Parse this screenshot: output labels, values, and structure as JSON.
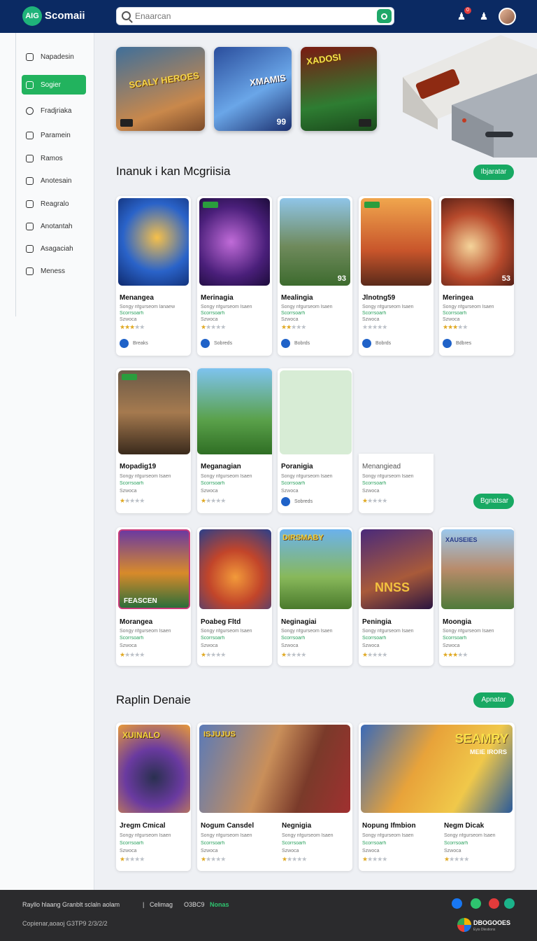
{
  "header": {
    "logo_mark": "AIG",
    "app_name": "Scomaii",
    "search_placeholder": "Enaarcan",
    "notification_count": "0"
  },
  "sidebar": {
    "items": [
      {
        "label": "Napadesin",
        "icon": "home-icon"
      },
      {
        "label": "Sogier",
        "icon": "grid-icon",
        "active": true
      },
      {
        "label": "Fradjriaka",
        "icon": "user-icon"
      },
      {
        "label": "Paramein",
        "icon": "chart-icon"
      },
      {
        "label": "Ramos",
        "icon": "list-icon"
      },
      {
        "label": "Anotesain",
        "icon": "box-icon"
      },
      {
        "label": "Reagralo",
        "icon": "gamepad-icon"
      },
      {
        "label": "Anotantah",
        "icon": "pen-icon"
      },
      {
        "label": "Asagaciah",
        "icon": "calendar-icon"
      },
      {
        "label": "Meness",
        "icon": "settings-icon"
      }
    ]
  },
  "hero": [
    {
      "caption": "SCALY HEROES",
      "number": ""
    },
    {
      "caption": "XMAMIS",
      "number": "99"
    },
    {
      "caption": "XADOSI",
      "number": ""
    }
  ],
  "section1": {
    "title": "Inanuk i kan Mcgriisia",
    "button": "Ibjaratar"
  },
  "row1": [
    {
      "title": "Menangea",
      "sub1": "Songy nfgurseom lanaew",
      "sub2": "Scorrsoarh",
      "sub3": "Szwoca",
      "rating": 3,
      "meta": "Breaks",
      "num": ""
    },
    {
      "title": "Merinagia",
      "sub1": "Songy nfgurseom lsaen",
      "sub2": "Scorrsoarh",
      "sub3": "Szwoca",
      "rating": 1,
      "meta": "Sobreds",
      "num": ""
    },
    {
      "title": "Mealingia",
      "sub1": "Songy nfgurseom lsaen",
      "sub2": "Scorrsoarh",
      "sub3": "Szwoca",
      "rating": 2,
      "meta": "Bobrds",
      "num": "93"
    },
    {
      "title": "Jlnotng59",
      "sub1": "Songy nfgurseom lsaen",
      "sub2": "Scorrsoarh",
      "sub3": "Szwoca",
      "rating": 0,
      "meta": "Bobrds",
      "num": ""
    },
    {
      "title": "Meringea",
      "sub1": "Songy nfgurseom lsaen",
      "sub2": "Scorrsoarh",
      "sub3": "Szwoca",
      "rating": 3,
      "meta": "Bdbres",
      "num": "53"
    }
  ],
  "row2": [
    {
      "title": "Mopadig19",
      "sub1": "Songy nfgurseom lsaen",
      "sub2": "Scorrsoarh",
      "sub3": "Szwoca",
      "rating": 1,
      "meta": ""
    },
    {
      "title": "Meganagian",
      "sub1": "Songy nfgurseom lsaen",
      "sub2": "Scorrsoarh",
      "sub3": "Szwoca",
      "rating": 1,
      "meta": ""
    },
    {
      "title": "Poranigia",
      "sub1": "Songy nfgurseom lsaen",
      "sub2": "Scorrsoarh",
      "sub3": "Szwoca",
      "rating": 0,
      "meta": "Sobreds"
    },
    {
      "title": "Menangiead",
      "sub1": "Songy nfgurseom lsaen",
      "sub2": "Scorrsoarh",
      "sub3": "Szwoca",
      "rating": 1,
      "meta": ""
    }
  ],
  "row2_button": "Bgnatsar",
  "row3": [
    {
      "title": "Morangea",
      "sub1": "Songy nfgurseom lsaen",
      "sub2": "Scorrsoarh",
      "sub3": "Szwoca",
      "rating": 1,
      "caption": "FEASCEN"
    },
    {
      "title": "Poabeg Fltd",
      "sub1": "Songy nfgurseom lsaen",
      "sub2": "Scorrsoarh",
      "sub3": "Szwoca",
      "rating": 1,
      "caption": ""
    },
    {
      "title": "Neginagiai",
      "sub1": "Songy nfgurseom lsaen",
      "sub2": "Scorrsoarh",
      "sub3": "Szwoca",
      "rating": 1,
      "caption": "DIRSMABY"
    },
    {
      "title": "Peningia",
      "sub1": "Songy nfgurseom lsaen",
      "sub2": "Scorrsoarh",
      "sub3": "Szwoca",
      "rating": 1,
      "caption": "NNSS"
    },
    {
      "title": "Moongia",
      "sub1": "Songy nfgurseom lsaen",
      "sub2": "Scorrsoarh",
      "sub3": "Szwoca",
      "rating": 3,
      "caption": "XAUSEIES"
    }
  ],
  "section2": {
    "title": "Raplin Denaie",
    "button": "Apnatar"
  },
  "row4": [
    {
      "title": "Jregm Cmical",
      "sub1": "Songy nfgurseom lsaen",
      "sub2": "Scorrsoarh",
      "sub3": "Szwoca",
      "rating": 1,
      "caption": "XUINALO"
    },
    {
      "title": "Nogum Cansdel",
      "sub1": "Songy nfgurseom lsaen",
      "sub2": "Scorrsoarh",
      "sub3": "Szwoca",
      "rating": 1,
      "caption": "ISJUJUS"
    },
    {
      "title": "Negnigia",
      "sub1": "Songy nfgurseom lsaen",
      "sub2": "Scorrsoarh",
      "sub3": "Szwoca",
      "rating": 1,
      "caption": ""
    },
    {
      "title": "Nopung Ifmbion",
      "sub1": "Songy nfgurseom lsaen",
      "sub2": "Scorrsoarh",
      "sub3": "Szwoca",
      "rating": 1,
      "caption": "SEAMRY"
    },
    {
      "title": "Negm Dicak",
      "sub1": "Songy nfgurseom lsaen",
      "sub2": "Scorrsoarh",
      "sub3": "Szwoca",
      "rating": 1,
      "caption": "MEIE IRORS"
    }
  ],
  "footer": {
    "text": "Rayllo hlaang Granblt sclaln aolam",
    "link1": "Celimag",
    "link2": "O3BC9",
    "link3": "Nonas",
    "copyright": "Copienar,aoaoj G3TP9 2/3/2/2",
    "partner_name": "DBOGOOES",
    "partner_sub": "Eyis Dlestions"
  },
  "colors": {
    "topbar": "#0b2a63",
    "accent": "#22b35e",
    "footer": "#2b2b2d"
  }
}
